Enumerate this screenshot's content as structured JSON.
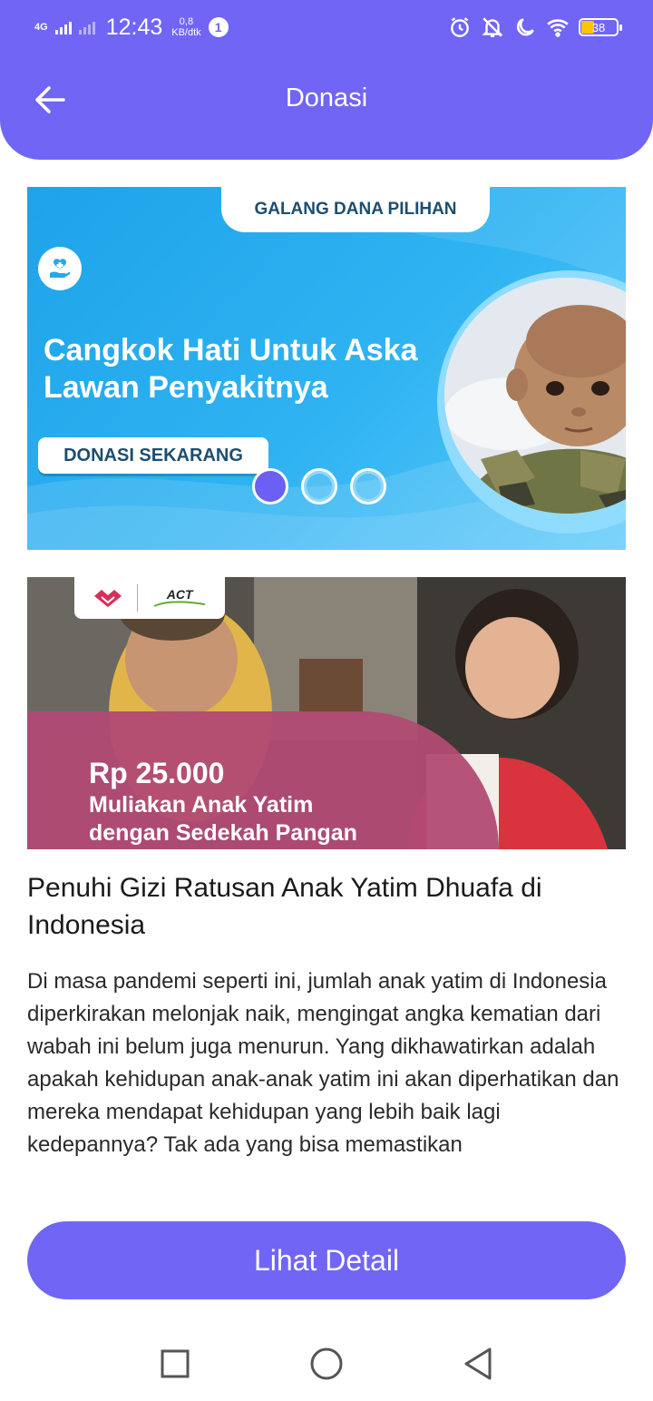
{
  "status_bar": {
    "network": "4G",
    "time": "12:43",
    "speed_value": "0,8",
    "speed_unit": "KB/dtk",
    "notification_count": "1",
    "battery_level": "38"
  },
  "header": {
    "title": "Donasi",
    "back_icon": "arrow-left-icon"
  },
  "banner": {
    "tab_label": "GALANG DANA PILIHAN",
    "heading": "Cangkok Hati Untuk Aska Lawan Penyakitnya",
    "cta_label": "DONASI SEKARANG",
    "icon": "care-hand-heart-icon",
    "carousel": {
      "count": 3,
      "active_index": 0
    }
  },
  "campaign": {
    "logo_text": "ACT",
    "price": "Rp 25.000",
    "caption_line1": "Muliakan Anak Yatim",
    "caption_line2": "dengan Sedekah Pangan",
    "title": "Penuhi Gizi Ratusan Anak Yatim Dhuafa di Indonesia",
    "description": "Di masa pandemi seperti ini, jumlah anak yatim di Indonesia diperkirakan melonjak naik, mengingat angka kematian dari wabah ini belum juga menurun. Yang dikhawatirkan adalah apakah kehidupan anak-anak yatim ini akan diperhatikan dan mereka mendapat kehidupan yang lebih baik lagi kedepannya? Tak ada yang bisa memastikan"
  },
  "detail_button": {
    "label": "Lihat Detail"
  },
  "nav_bar": {
    "recent_icon": "square-icon",
    "home_icon": "circle-icon",
    "back_icon": "triangle-back-icon"
  },
  "colors": {
    "primary": "#7165f6",
    "banner_blue": "#2fb3f2",
    "overlay_pink": "#b14a73",
    "battery_yellow": "#ffc300"
  }
}
